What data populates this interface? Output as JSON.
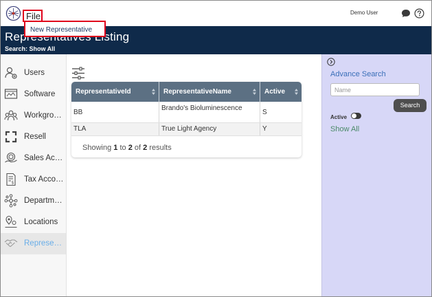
{
  "topbar": {
    "file_label": "File",
    "user_name": "Demo User"
  },
  "dropdown": {
    "item_label": "New Representative"
  },
  "header": {
    "title": "Representatives Listing",
    "subtitle": "Search: Show All"
  },
  "sidebar": {
    "items": [
      {
        "label": "Users",
        "icon": "users-icon"
      },
      {
        "label": "Software",
        "icon": "software-icon"
      },
      {
        "label": "Workgroups",
        "icon": "workgroups-icon"
      },
      {
        "label": "Resell",
        "icon": "resell-icon"
      },
      {
        "label": "Sales Accounts",
        "icon": "sales-accounts-icon"
      },
      {
        "label": "Tax Accounts",
        "icon": "tax-accounts-icon"
      },
      {
        "label": "Departments",
        "icon": "departments-icon"
      },
      {
        "label": "Locations",
        "icon": "locations-icon"
      },
      {
        "label": "Representatives",
        "icon": "representatives-icon",
        "active": true
      }
    ]
  },
  "table": {
    "columns": [
      "RepresentativeId",
      "RepresentativeName",
      "Active"
    ],
    "rows": [
      [
        "BB",
        "Brando's Bioluminescence",
        "S"
      ],
      [
        "TLA",
        "True Light Agency",
        "Y"
      ]
    ],
    "results": {
      "prefix": "Showing",
      "from": "1",
      "to_word": "to",
      "to": "2",
      "of_word": "of",
      "total": "2",
      "suffix": "results"
    }
  },
  "search_panel": {
    "title": "Advance Search",
    "name_placeholder": "Name",
    "search_button": "Search",
    "active_label": "Active",
    "active_on": false,
    "show_all": "Show All"
  },
  "colors": {
    "header_bg": "#0f2a4a",
    "table_header_bg": "#5c7083",
    "panel_bg": "#d7d7f7",
    "highlight_border": "#e0001b",
    "link_blue": "#3a6fb8",
    "active_nav": "#6aaee8"
  }
}
